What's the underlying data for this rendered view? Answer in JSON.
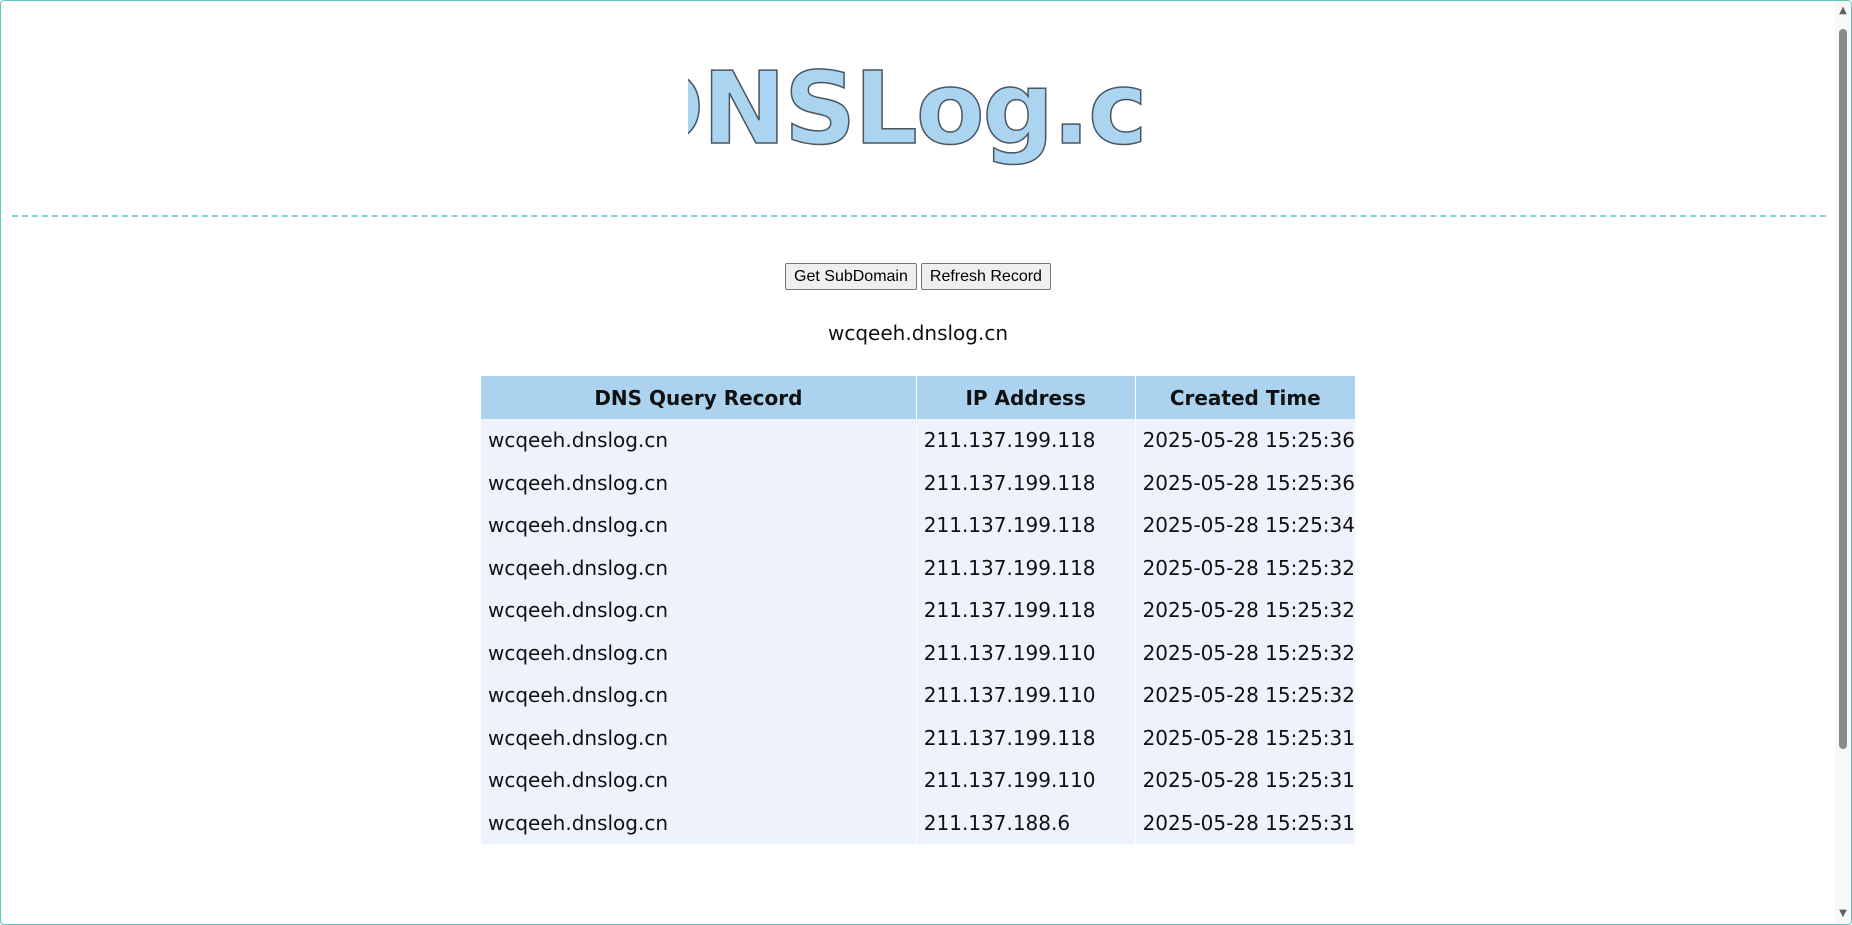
{
  "logo": {
    "text": "DNSLog.cn"
  },
  "buttons": {
    "get_subdomain": "Get SubDomain",
    "refresh_record": "Refresh Record"
  },
  "subdomain": "wcqeeh.dnslog.cn",
  "table": {
    "headers": [
      "DNS Query Record",
      "IP Address",
      "Created Time"
    ],
    "rows": [
      [
        "wcqeeh.dnslog.cn",
        "211.137.199.118",
        "2025-05-28 15:25:36"
      ],
      [
        "wcqeeh.dnslog.cn",
        "211.137.199.118",
        "2025-05-28 15:25:36"
      ],
      [
        "wcqeeh.dnslog.cn",
        "211.137.199.118",
        "2025-05-28 15:25:34"
      ],
      [
        "wcqeeh.dnslog.cn",
        "211.137.199.118",
        "2025-05-28 15:25:32"
      ],
      [
        "wcqeeh.dnslog.cn",
        "211.137.199.118",
        "2025-05-28 15:25:32"
      ],
      [
        "wcqeeh.dnslog.cn",
        "211.137.199.110",
        "2025-05-28 15:25:32"
      ],
      [
        "wcqeeh.dnslog.cn",
        "211.137.199.110",
        "2025-05-28 15:25:32"
      ],
      [
        "wcqeeh.dnslog.cn",
        "211.137.199.118",
        "2025-05-28 15:25:31"
      ],
      [
        "wcqeeh.dnslog.cn",
        "211.137.199.110",
        "2025-05-28 15:25:31"
      ],
      [
        "wcqeeh.dnslog.cn",
        "211.137.188.6",
        "2025-05-28 15:25:31"
      ]
    ]
  },
  "colors": {
    "logo_fill": "#aad4f0",
    "logo_stroke": "#4a5660",
    "divider": "#7ecfe0",
    "header_bg": "#abd3ef",
    "row_bg": "#edf2fc"
  },
  "icons": {
    "scroll_up": "scroll-up-arrow-icon",
    "scroll_down": "scroll-down-arrow-icon"
  }
}
